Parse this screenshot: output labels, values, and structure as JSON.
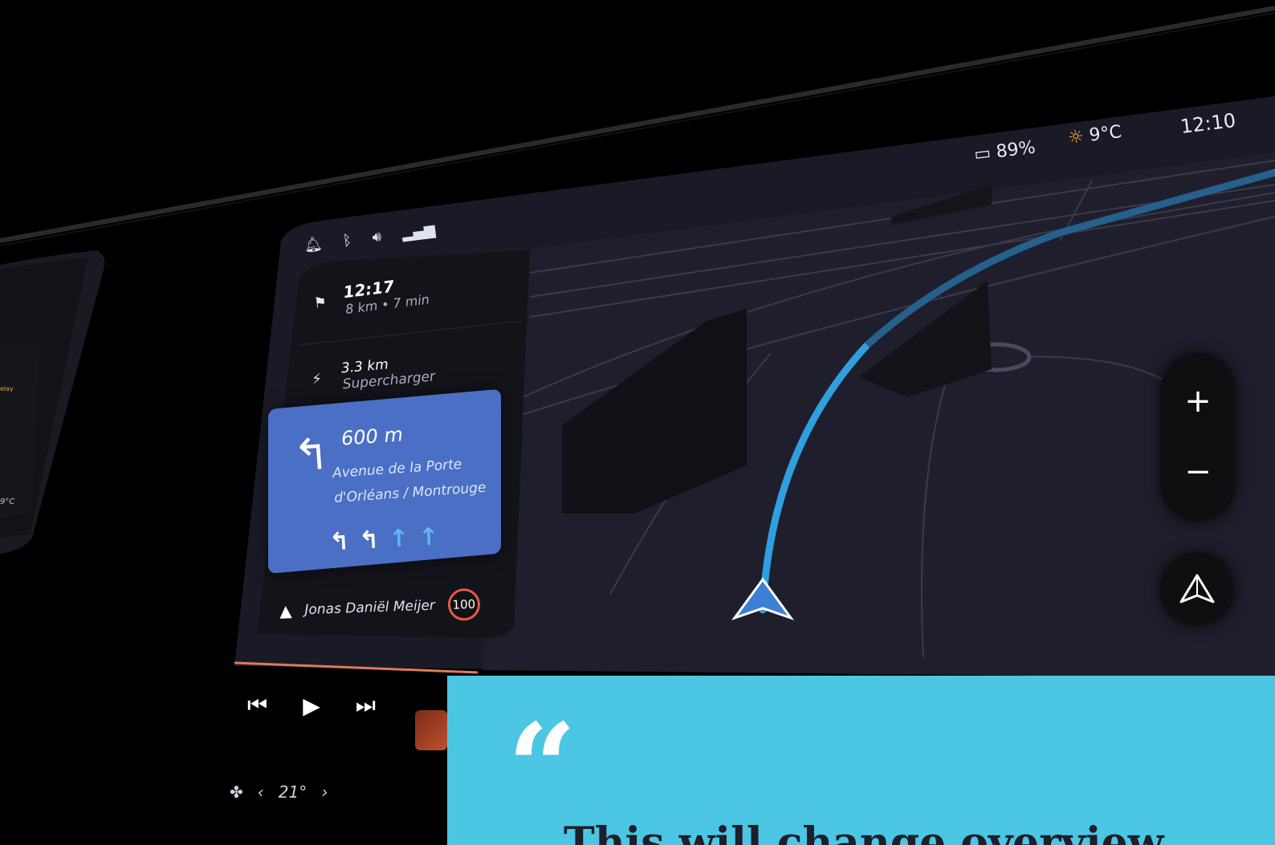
{
  "status_bar": {
    "battery": "89%",
    "temperature": "9°C",
    "time": "12:10"
  },
  "status_icons": [
    "bell-icon",
    "bluetooth-icon",
    "volume-icon",
    "signal-icon"
  ],
  "navigation": {
    "eta_time": "12:17",
    "eta_summary": "8 km • 7 min",
    "charger_distance": "3.3 km",
    "charger_name": "Supercharger",
    "next_turn_distance": "600 m",
    "next_turn_street": "Avenue de la Porte d'Orléans / Montrouge",
    "current_street": "Jonas Daniël Meijer",
    "speed_limit": "100"
  },
  "map_controls": {
    "zoom_in": "+",
    "zoom_out": "−"
  },
  "media": {
    "prev": "⏮",
    "play": "▶",
    "next": "⏭"
  },
  "climate": {
    "temperature": "21°",
    "decrease": "‹",
    "increase": "›"
  },
  "left_screen": {
    "temperature": "9°C",
    "relay_label": "elay"
  },
  "quote": {
    "mark": "“",
    "text": "This will change overview"
  },
  "colors": {
    "accent_blue": "#4a6fc4",
    "route_blue": "#2f9fe0",
    "speed_red": "#e35a4a",
    "quote_bg": "#4bc6e3"
  }
}
